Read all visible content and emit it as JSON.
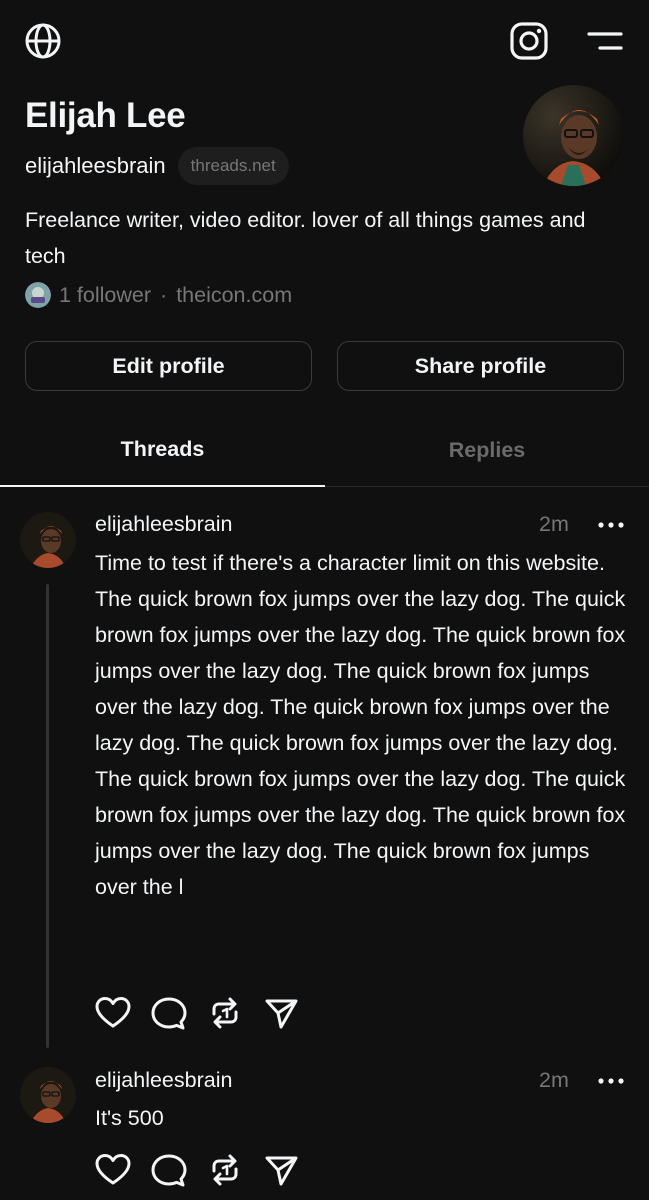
{
  "topbar": {
    "left_icon": "globe-icon",
    "right_icons": [
      "instagram-icon",
      "menu-icon"
    ]
  },
  "profile": {
    "name": "Elijah Lee",
    "handle": "elijahleesbrain",
    "domain": "threads.net",
    "bio": "Freelance writer, video editor. lover of all things games and tech",
    "followers": "1 follower",
    "separator": "·",
    "link": "theicon.com"
  },
  "buttons": {
    "edit": "Edit profile",
    "share": "Share profile"
  },
  "tabs": [
    {
      "label": "Threads",
      "active": true
    },
    {
      "label": "Replies",
      "active": false
    }
  ],
  "posts": [
    {
      "user": "elijahleesbrain",
      "time": "2m",
      "paragraphs": [
        "Time to test if there's a character limit on this website.",
        "The quick brown fox jumps over the lazy dog. The quick brown fox jumps over the lazy dog. The quick brown fox jumps over the lazy dog. The quick brown fox jumps over the lazy dog. The quick brown fox jumps over the lazy dog. The quick brown fox jumps over the lazy dog. The quick brown fox jumps over the lazy dog. The quick brown fox jumps over the lazy dog. The quick brown fox jumps over the lazy dog. The quick brown fox jumps over the l"
      ]
    },
    {
      "user": "elijahleesbrain",
      "time": "2m",
      "paragraphs": [
        "It's 500"
      ]
    }
  ],
  "action_icons": [
    "heart-icon",
    "comment-icon",
    "repost-icon",
    "send-icon"
  ],
  "colors": {
    "background": "#101010",
    "text": "#f3f5f7",
    "muted": "#777777",
    "border": "#3a3a3a"
  }
}
